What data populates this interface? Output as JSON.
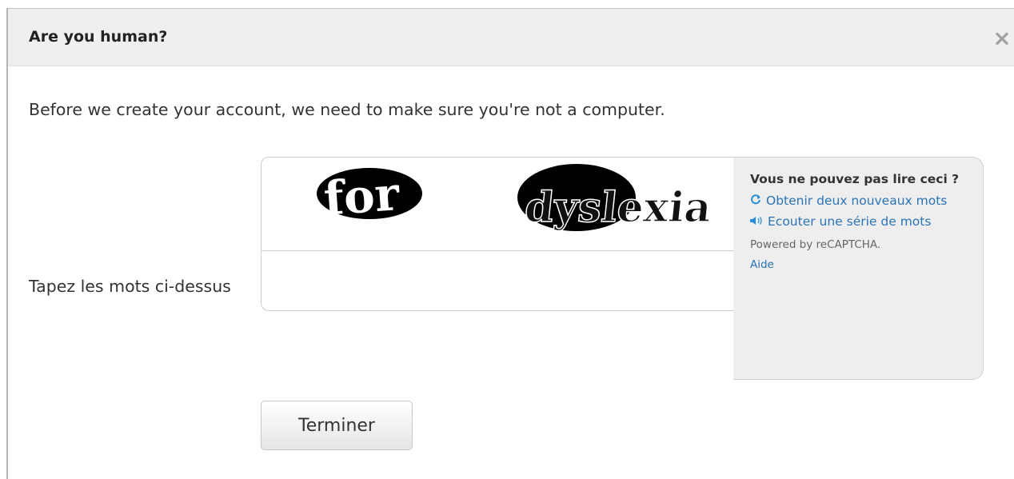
{
  "dialog": {
    "title": "Are you human?",
    "close_label": "×",
    "intro": "Before we create your account, we need to make sure you're not a computer."
  },
  "captcha": {
    "field_label": "Tapez les mots ci-dessus",
    "word_1": "for",
    "word_2": "dyslexia",
    "input_value": "",
    "sidebar": {
      "heading": "Vous ne pouvez pas lire ceci ?",
      "new_words_link": "Obtenir deux nouveaux mots",
      "audio_link": "Ecouter une série de mots",
      "powered_by": "Powered by reCAPTCHA.",
      "help_link": "Aide"
    },
    "icons": {
      "refresh": "refresh-icon",
      "audio": "speaker-icon"
    }
  },
  "actions": {
    "submit_label": "Terminer"
  },
  "colors": {
    "header_bg": "#efefef",
    "link": "#2a73b7",
    "sidebar_bg": "#eeeeee"
  }
}
